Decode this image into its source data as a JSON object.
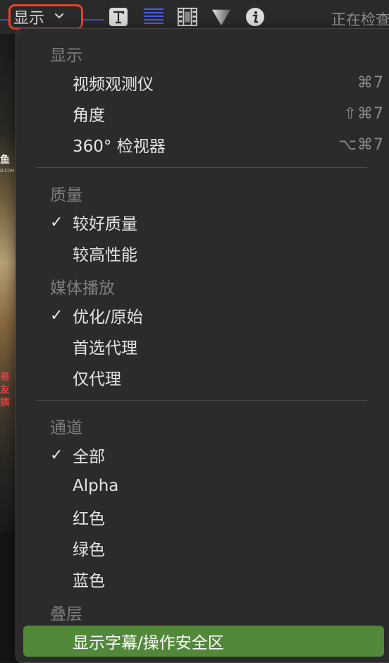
{
  "toolbar": {
    "show_label": "显示",
    "status_text": "正在检查"
  },
  "menu": {
    "display": {
      "header": "显示",
      "items": [
        {
          "label": "视频观测仪",
          "shortcut": "⌘7"
        },
        {
          "label": "角度",
          "shortcut": "⇧⌘7"
        },
        {
          "label": "360° 检视器",
          "shortcut": "⌥⌘7"
        }
      ]
    },
    "quality": {
      "header": "质量",
      "items": [
        {
          "label": "较好质量",
          "checked": true
        },
        {
          "label": "较高性能",
          "checked": false
        }
      ]
    },
    "media_playback": {
      "header": "媒体播放",
      "items": [
        {
          "label": "优化/原始",
          "checked": true
        },
        {
          "label": "首选代理",
          "checked": false
        },
        {
          "label": "仅代理",
          "checked": false
        }
      ]
    },
    "channels": {
      "header": "通道",
      "items": [
        {
          "label": "全部",
          "checked": true
        },
        {
          "label": "Alpha",
          "checked": false
        },
        {
          "label": "红色",
          "checked": false
        },
        {
          "label": "绿色",
          "checked": false
        },
        {
          "label": "蓝色",
          "checked": false
        }
      ]
    },
    "overlays": {
      "header": "叠层",
      "items": [
        {
          "label": "显示字幕/操作安全区",
          "selected": true
        }
      ]
    },
    "check_glyph": "✓"
  },
  "background_poster": {
    "chars": [
      "鱼",
      "哥",
      "友",
      "姨"
    ],
    "small_text": "U.COM"
  },
  "colors": {
    "highlight": "#52883a",
    "focus_ring": "#e5432d",
    "accent_blue": "#3d4dd8"
  }
}
